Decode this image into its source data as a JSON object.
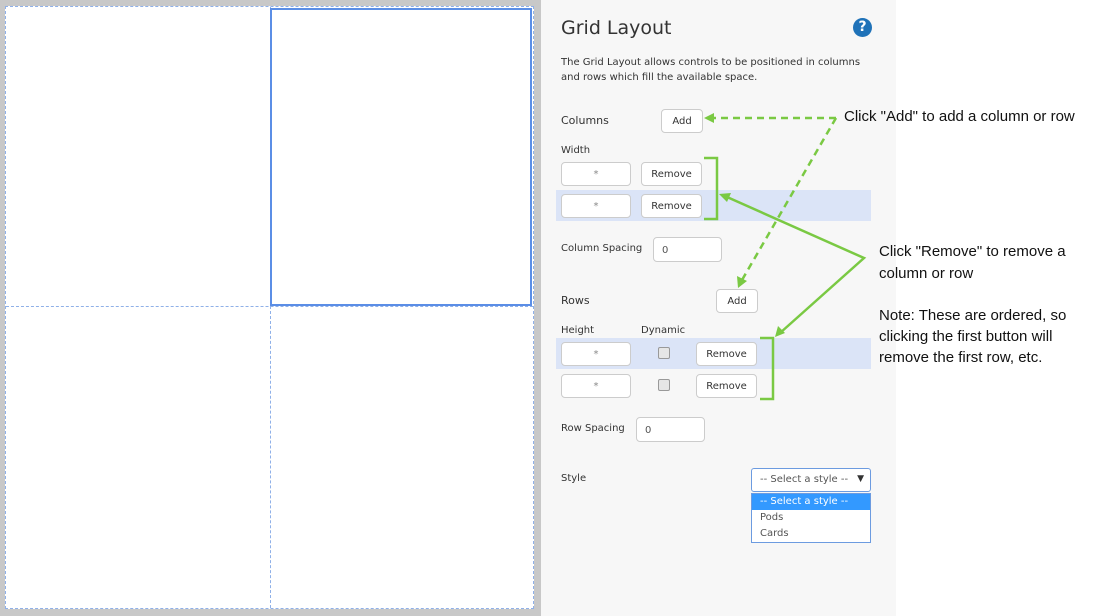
{
  "panel": {
    "title": "Grid Layout",
    "help_icon": "question-circle-icon",
    "description": "The Grid Layout allows controls to be positioned in columns and rows which fill the available space.",
    "columns": {
      "label": "Columns",
      "add_label": "Add",
      "width_label": "Width",
      "items": [
        {
          "width": "*",
          "remove_label": "Remove"
        },
        {
          "width": "*",
          "remove_label": "Remove"
        }
      ],
      "spacing_label": "Column Spacing",
      "spacing_value": "0"
    },
    "rows": {
      "label": "Rows",
      "add_label": "Add",
      "height_label": "Height",
      "dynamic_label": "Dynamic",
      "items": [
        {
          "height": "*",
          "dynamic": false,
          "remove_label": "Remove"
        },
        {
          "height": "*",
          "dynamic": false,
          "remove_label": "Remove"
        }
      ],
      "spacing_label": "Row Spacing",
      "spacing_value": "0"
    },
    "style": {
      "label": "Style",
      "selected": "-- Select a style --",
      "options": [
        "-- Select a style --",
        "Pods",
        "Cards"
      ]
    }
  },
  "annotations": {
    "add_note": "Click \"Add\" to add a column or row",
    "remove_note_1": "Click \"Remove\" to remove a",
    "remove_note_2": "column or row",
    "order_note_1": "Note: These are ordered, so",
    "order_note_2": "clicking the first button will",
    "order_note_3": "remove the first row, etc.",
    "arrow_color": "#7ac943"
  }
}
